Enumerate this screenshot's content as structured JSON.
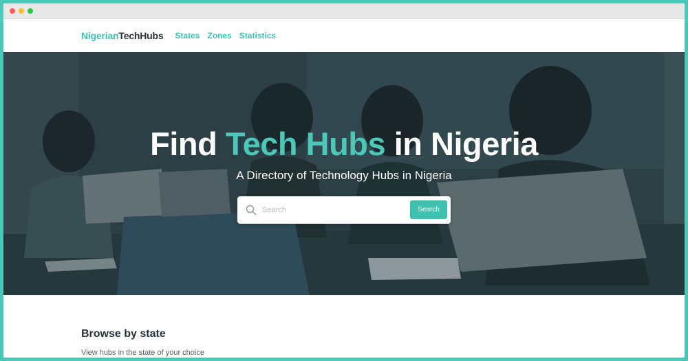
{
  "window": {
    "traffic_lights": [
      "#fe5f57",
      "#febc2e",
      "#28c840"
    ]
  },
  "navbar": {
    "brand_part1": "Nigerian",
    "brand_part2": "TechHubs",
    "links": [
      "States",
      "Zones",
      "Statistics"
    ]
  },
  "hero": {
    "title_before": "Find ",
    "title_accent": "Tech Hubs",
    "title_after": " in Nigeria",
    "subtitle": "A Directory of Technology Hubs in Nigeria",
    "background": "photo of women working on laptops at a meeting table"
  },
  "search": {
    "placeholder": "Search",
    "button_label": "Search",
    "icon": "search-icon"
  },
  "browse": {
    "title": "Browse by state",
    "subtitle": "View hubs in the state of your choice"
  },
  "colors": {
    "accent": "#3fc1b0",
    "frame": "#4dc7b7",
    "dark_text": "#263238"
  }
}
